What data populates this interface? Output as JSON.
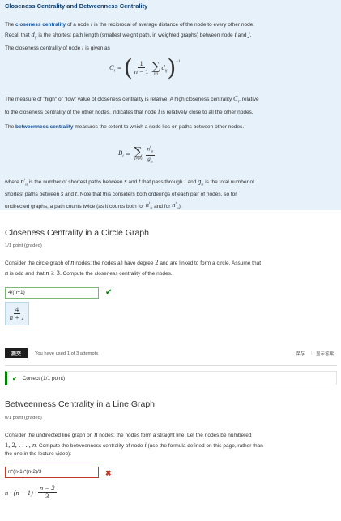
{
  "intro": {
    "title": "Closeness Centrality and Betweenness Centrality",
    "p1_a": "The ",
    "p1_strong": "closeness centrality",
    "p1_b": " of a node ",
    "p1_c": " is the reciprocal of average distance of the node to every other node.",
    "p1_d": "Recall that ",
    "p1_e": " is the shortest path length (smallest weight path, in weighted graphs) between node ",
    "p1_f": " and ",
    "p1_g": ".",
    "p1_h": "The closeness centrality of node ",
    "p1_i": " is given as",
    "p2_a": "The measure of \"high\" or \"low\" value of closeness centrality is relative. A high closeness centrality ",
    "p2_b": ", relative",
    "p2_c": "to the closeness centrality of the other nodes, indicates that node ",
    "p2_d": " is relatively close to all the other nodes.",
    "p3_a": "The ",
    "p3_strong": "betweenness centrality",
    "p3_b": " measures the extent to which a node lies on paths between other nodes.",
    "p4_a": "where ",
    "p4_b": " is the number of shortest paths between ",
    "p4_c": " and ",
    "p4_d": " that pass through ",
    "p4_e": " and ",
    "p4_f": " is the total number of",
    "p4_g": "shortest paths between ",
    "p4_h": " and ",
    "p4_i": ". Note that this considers both orderings of each pair of nodes, so for",
    "p4_j": "undirected graphs, a path counts twice (as it counts both for ",
    "p4_k": " and for ",
    "p4_l": ")."
  },
  "problem1": {
    "title": "Closeness Centrality in a Circle Graph",
    "points": "1/1 point (graded)",
    "text_a": "Consider the circle graph of ",
    "text_b": " nodes: the nodes all have degree ",
    "text_c": " and are linked to form a circle. Assume that",
    "text_d": " is odd and that ",
    "text_e": ". Compute the closeness centrality of the nodes.",
    "answer_value": "4/(n+1)",
    "preview_num": "4",
    "preview_den": "n + 1",
    "submit_label": "提交",
    "attempts": "You have used 1 of 3 attempts",
    "save_label": "保存",
    "show_answer_label": "显示答案",
    "feedback": "Correct (1/1 point)"
  },
  "problem2": {
    "title": "Betweenness Centrality in a Line Graph",
    "points": "0/1 point (graded)",
    "text_a": "Consider the undirected line graph on ",
    "text_b": " nodes: the nodes form a straight line. Let the nodes be numbered",
    "text_c": ". Compute the betweenness centrality of node ",
    "text_d": " (use the formula defined on this page, rather than",
    "text_e": "the one in the lecture video):",
    "answer_value": "n*(n-1)*(n-2)/3",
    "preview_a": "n · (n − 1) · ",
    "preview_num": "n − 2",
    "preview_den": "3"
  },
  "colors": {
    "intro_bg": "#e6f1fa",
    "accent": "#12509a",
    "correct": "#008100",
    "wrong": "#c0392b"
  }
}
